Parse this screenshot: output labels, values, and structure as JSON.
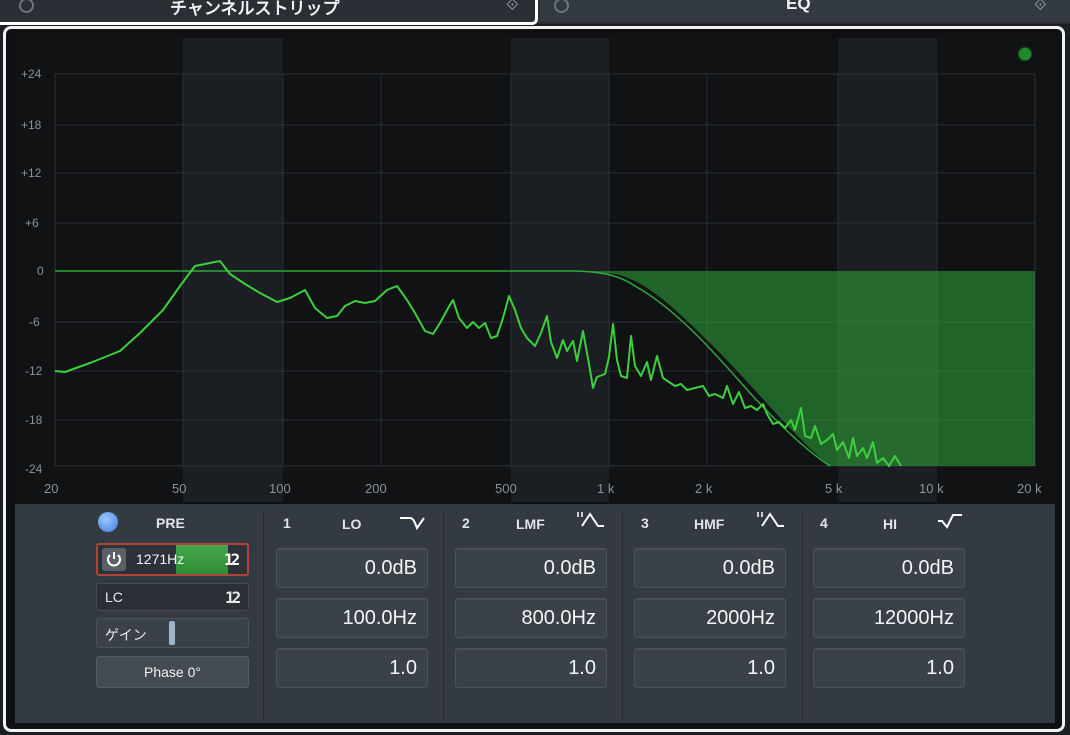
{
  "tabs": {
    "channel_strip": "チャンネルストリップ",
    "eq": "EQ"
  },
  "graph": {
    "y_ticks": [
      "+24",
      "+18",
      "+12",
      "+6",
      "0",
      "-6",
      "-12",
      "-18",
      "-24"
    ],
    "x_ticks": [
      "20",
      "50",
      "100",
      "200",
      "500",
      "1 k",
      "2 k",
      "5 k",
      "10 k",
      "20 k"
    ]
  },
  "pre": {
    "label": "PRE",
    "highcut_value": "1271Hz",
    "highcut_slope": "12",
    "lowcut_label": "LC",
    "lowcut_slope": "12",
    "gain_label": "ゲイン",
    "phase_label": "Phase 0°"
  },
  "bands": [
    {
      "num": "1",
      "name": "LO",
      "gain": "0.0dB",
      "freq": "100.0Hz",
      "q": "1.0"
    },
    {
      "num": "2",
      "name": "LMF",
      "gain": "0.0dB",
      "freq": "800.0Hz",
      "q": "1.0"
    },
    {
      "num": "3",
      "name": "HMF",
      "gain": "0.0dB",
      "freq": "2000Hz",
      "q": "1.0"
    },
    {
      "num": "4",
      "name": "HI",
      "gain": "0.0dB",
      "freq": "12000Hz",
      "q": "1.0"
    }
  ],
  "colors": {
    "curve": "#3ccf3c",
    "filter_fill": "#2fa83a",
    "panel": "#343a41"
  }
}
